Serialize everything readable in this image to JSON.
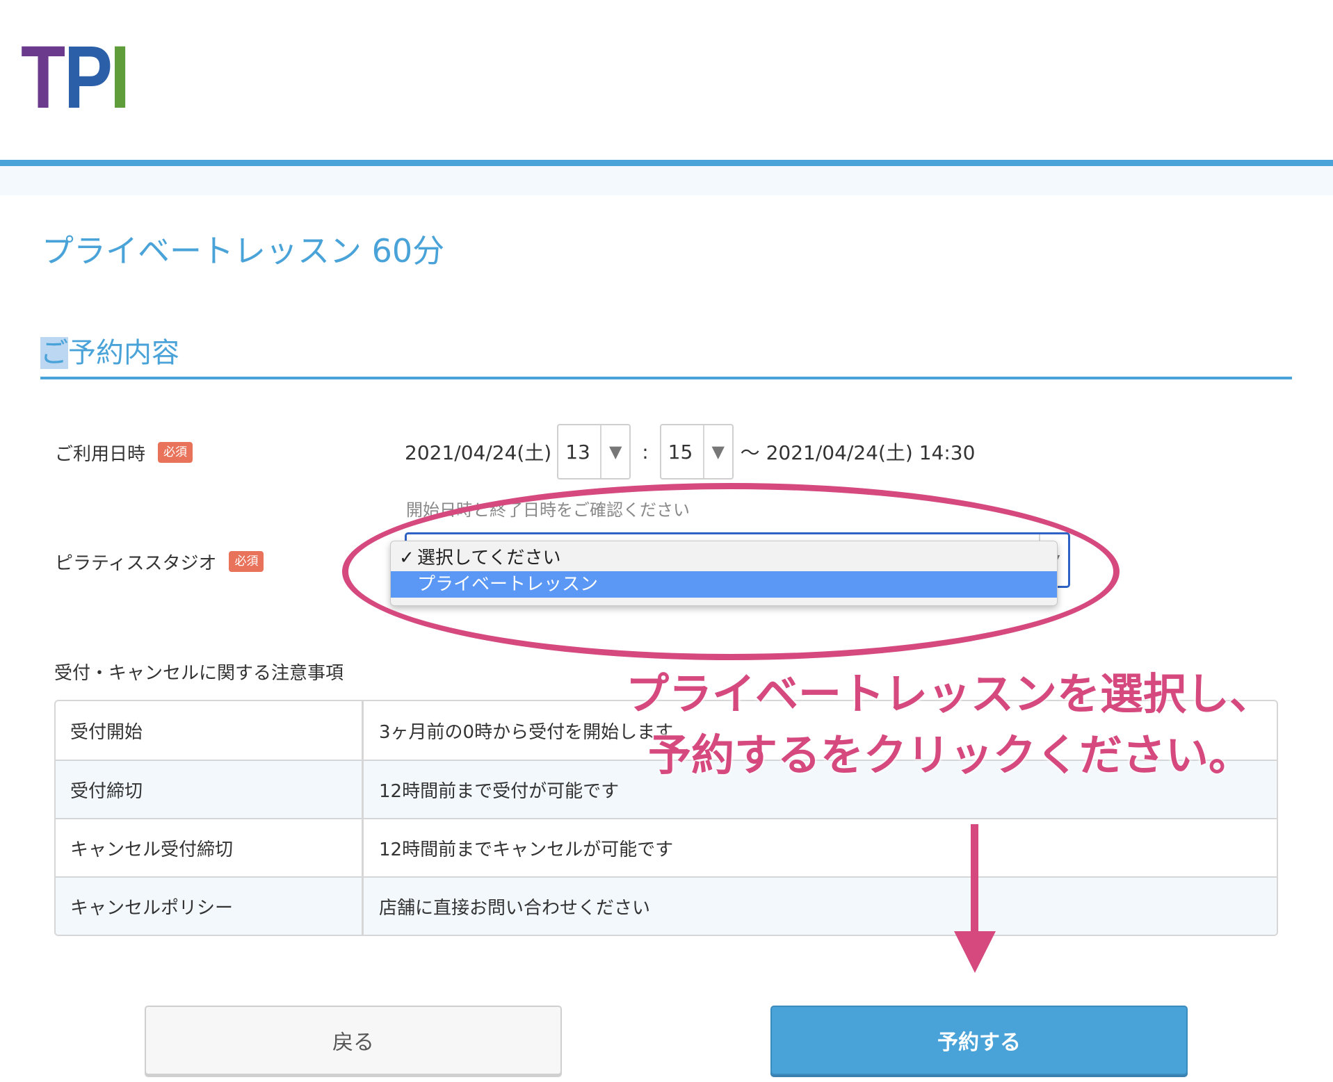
{
  "header": {
    "logo_letters": [
      "T",
      "P",
      "I"
    ],
    "logo_colors": [
      "#6b3a8c",
      "#2b5fa8",
      "#5f9c3a"
    ],
    "accent_color": "#4aa3d8"
  },
  "page_title": "プライベートレッスン 60分",
  "section": {
    "title_highlight": "ご",
    "title_rest": "予約内容"
  },
  "form": {
    "datetime": {
      "label": "ご利用日時",
      "required": "必須",
      "start_date": "2021/04/24(土)",
      "hour": "13",
      "separator": ":",
      "minute": "15",
      "end": "〜 2021/04/24(土) 14:30",
      "hint": "開始日時と終了日時をご確認ください"
    },
    "studio": {
      "label": "ピラティススタジオ",
      "required": "必須",
      "options": [
        {
          "label": "選択してください",
          "checked": true
        },
        {
          "label": "プライベートレッスン",
          "highlighted": true
        }
      ]
    }
  },
  "notes": {
    "title": "受付・キャンセルに関する注意事項",
    "rows": [
      {
        "key": "受付開始",
        "value": "3ヶ月前の0時から受付を開始します"
      },
      {
        "key": "受付締切",
        "value": "12時間前まで受付が可能です"
      },
      {
        "key": "キャンセル受付締切",
        "value": "12時間前までキャンセルが可能です"
      },
      {
        "key": "キャンセルポリシー",
        "value": "店舗に直接お問い合わせください"
      }
    ]
  },
  "annotation": {
    "line1": "プライベートレッスンを選択し、",
    "line2": "予約するをクリックください。",
    "color": "#d5497e"
  },
  "buttons": {
    "back": "戻る",
    "reserve": "予約する"
  },
  "icons": {
    "select_arrow": "triangle-down-icon",
    "check": "checkmark-icon"
  }
}
